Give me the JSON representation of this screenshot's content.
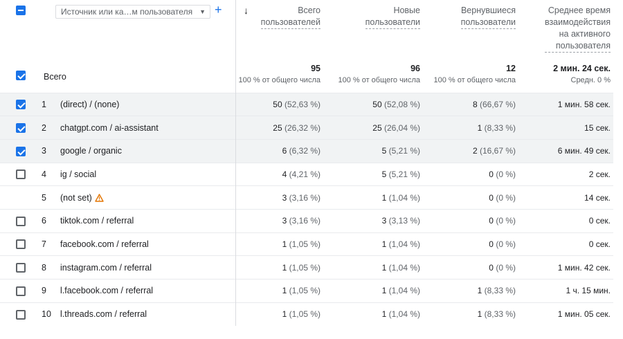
{
  "dimension_picker": {
    "label": "Источник или ка…м пользователя",
    "add_label": "+"
  },
  "columns": [
    {
      "title_lines": [
        "Всего",
        "пользователей"
      ]
    },
    {
      "title_lines": [
        "Новые",
        "пользователи"
      ]
    },
    {
      "title_lines": [
        "Вернувшиеся",
        "пользователи"
      ]
    },
    {
      "title_lines": [
        "Среднее время",
        "взаимодействия",
        "на активного",
        "пользователя"
      ]
    }
  ],
  "sort_indicator": "↓",
  "total": {
    "label": "Всего",
    "values": [
      "95",
      "96",
      "12",
      "2 мин. 24 сек."
    ],
    "subs": [
      "100 % от общего числа",
      "100 % от общего числа",
      "100 % от общего числа",
      "Средн. 0 %"
    ]
  },
  "rows": [
    {
      "n": "1",
      "name": "(direct) / (none)",
      "checked": true,
      "cells": [
        {
          "v": "50",
          "p": "(52,63 %)"
        },
        {
          "v": "50",
          "p": "(52,08 %)"
        },
        {
          "v": "8",
          "p": "(66,67 %)"
        },
        {
          "v": "1 мин. 58 сек.",
          "p": ""
        }
      ]
    },
    {
      "n": "2",
      "name": "chatgpt.com / ai-assistant",
      "checked": true,
      "cells": [
        {
          "v": "25",
          "p": "(26,32 %)"
        },
        {
          "v": "25",
          "p": "(26,04 %)"
        },
        {
          "v": "1",
          "p": "(8,33 %)"
        },
        {
          "v": "15 сек.",
          "p": ""
        }
      ]
    },
    {
      "n": "3",
      "name": "google / organic",
      "checked": true,
      "cells": [
        {
          "v": "6",
          "p": "(6,32 %)"
        },
        {
          "v": "5",
          "p": "(5,21 %)"
        },
        {
          "v": "2",
          "p": "(16,67 %)"
        },
        {
          "v": "6 мин. 49 сек.",
          "p": ""
        }
      ]
    },
    {
      "n": "4",
      "name": "ig / social",
      "checked": false,
      "cells": [
        {
          "v": "4",
          "p": "(4,21 %)"
        },
        {
          "v": "5",
          "p": "(5,21 %)"
        },
        {
          "v": "0",
          "p": "(0 %)"
        },
        {
          "v": "2 сек.",
          "p": ""
        }
      ]
    },
    {
      "n": "5",
      "name": "(not set)",
      "checked": null,
      "warning": true,
      "cells": [
        {
          "v": "3",
          "p": "(3,16 %)"
        },
        {
          "v": "1",
          "p": "(1,04 %)"
        },
        {
          "v": "0",
          "p": "(0 %)"
        },
        {
          "v": "14 сек.",
          "p": ""
        }
      ]
    },
    {
      "n": "6",
      "name": "tiktok.com / referral",
      "checked": false,
      "cells": [
        {
          "v": "3",
          "p": "(3,16 %)"
        },
        {
          "v": "3",
          "p": "(3,13 %)"
        },
        {
          "v": "0",
          "p": "(0 %)"
        },
        {
          "v": "0 сек.",
          "p": ""
        }
      ]
    },
    {
      "n": "7",
      "name": "facebook.com / referral",
      "checked": false,
      "cells": [
        {
          "v": "1",
          "p": "(1,05 %)"
        },
        {
          "v": "1",
          "p": "(1,04 %)"
        },
        {
          "v": "0",
          "p": "(0 %)"
        },
        {
          "v": "0 сек.",
          "p": ""
        }
      ]
    },
    {
      "n": "8",
      "name": "instagram.com / referral",
      "checked": false,
      "cells": [
        {
          "v": "1",
          "p": "(1,05 %)"
        },
        {
          "v": "1",
          "p": "(1,04 %)"
        },
        {
          "v": "0",
          "p": "(0 %)"
        },
        {
          "v": "1 мин. 42 сек.",
          "p": ""
        }
      ]
    },
    {
      "n": "9",
      "name": "l.facebook.com / referral",
      "checked": false,
      "cells": [
        {
          "v": "1",
          "p": "(1,05 %)"
        },
        {
          "v": "1",
          "p": "(1,04 %)"
        },
        {
          "v": "1",
          "p": "(8,33 %)"
        },
        {
          "v": "1 ч. 15 мин.",
          "p": ""
        }
      ]
    },
    {
      "n": "10",
      "name": "l.threads.com / referral",
      "checked": false,
      "cells": [
        {
          "v": "1",
          "p": "(1,05 %)"
        },
        {
          "v": "1",
          "p": "(1,04 %)"
        },
        {
          "v": "1",
          "p": "(8,33 %)"
        },
        {
          "v": "1 мин. 05 сек.",
          "p": ""
        }
      ]
    }
  ],
  "colors": {
    "accent": "#1a73e8",
    "selected_row": "#f1f3f4",
    "warning": "#e37400"
  }
}
